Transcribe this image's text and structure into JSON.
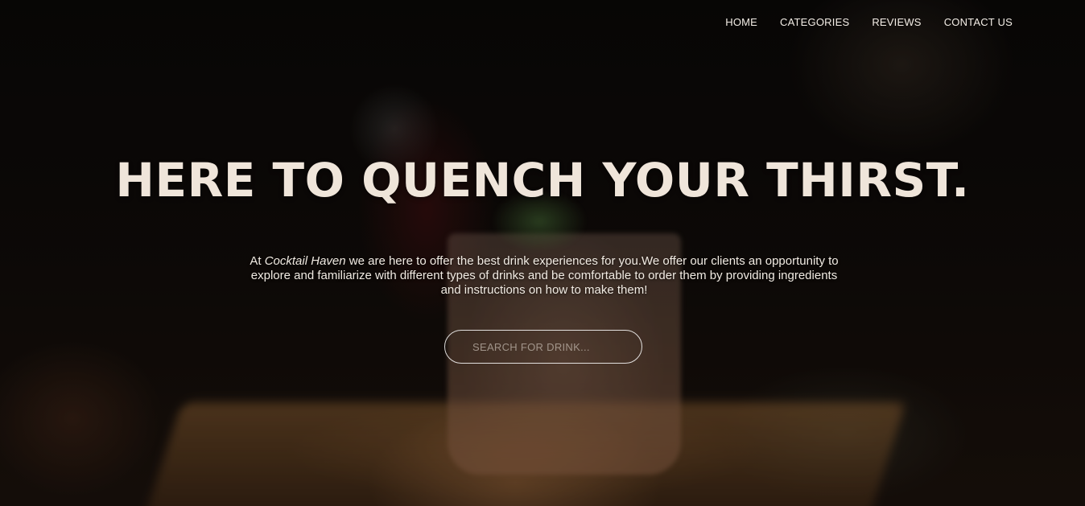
{
  "nav": {
    "items": [
      {
        "label": "HOME"
      },
      {
        "label": "CATEGORIES"
      },
      {
        "label": "REVIEWS"
      },
      {
        "label": "CONTACT US"
      }
    ]
  },
  "hero": {
    "headline": "HERE TO QUENCH YOUR THIRST.",
    "lead_prefix": "At ",
    "brand": "Cocktail Haven",
    "lead_suffix": " we are here to offer the best drink experiences for you.We offer our clients an opportunity to explore and familiarize with different types of drinks and be comfortable to order them by providing ingredients and instructions on how to make them!"
  },
  "search": {
    "placeholder": "SEARCH FOR DRINK..."
  },
  "colors": {
    "headline": "#efe5da",
    "text": "#f1ebe3"
  }
}
